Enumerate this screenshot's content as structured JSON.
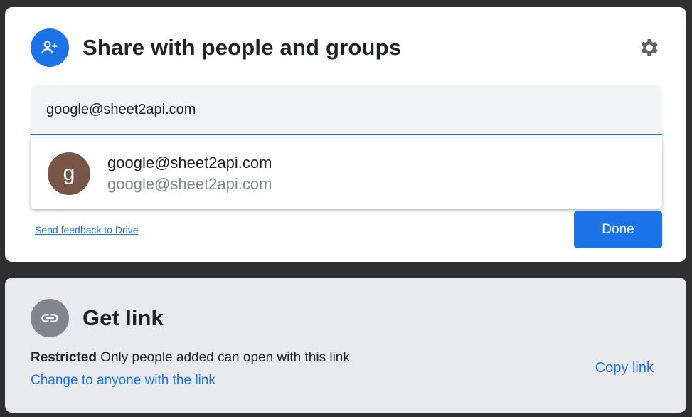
{
  "share": {
    "title": "Share with people and groups",
    "input_value": "google@sheet2api.com",
    "suggestion": {
      "avatar_letter": "g",
      "name": "google@sheet2api.com",
      "email": "google@sheet2api.com"
    },
    "feedback_link": "Send feedback to Drive",
    "done_label": "Done"
  },
  "get_link": {
    "title": "Get link",
    "restriction_bold": "Restricted",
    "restriction_desc": " Only people added can open with this link",
    "change_link": "Change to anyone with the link",
    "copy_link": "Copy link"
  },
  "icons": {
    "header": "person-add-icon",
    "settings": "gear-icon",
    "link": "link-icon"
  },
  "colors": {
    "accent": "#1a73e8",
    "avatar": "#795548",
    "link_icon_bg": "#80868b"
  }
}
